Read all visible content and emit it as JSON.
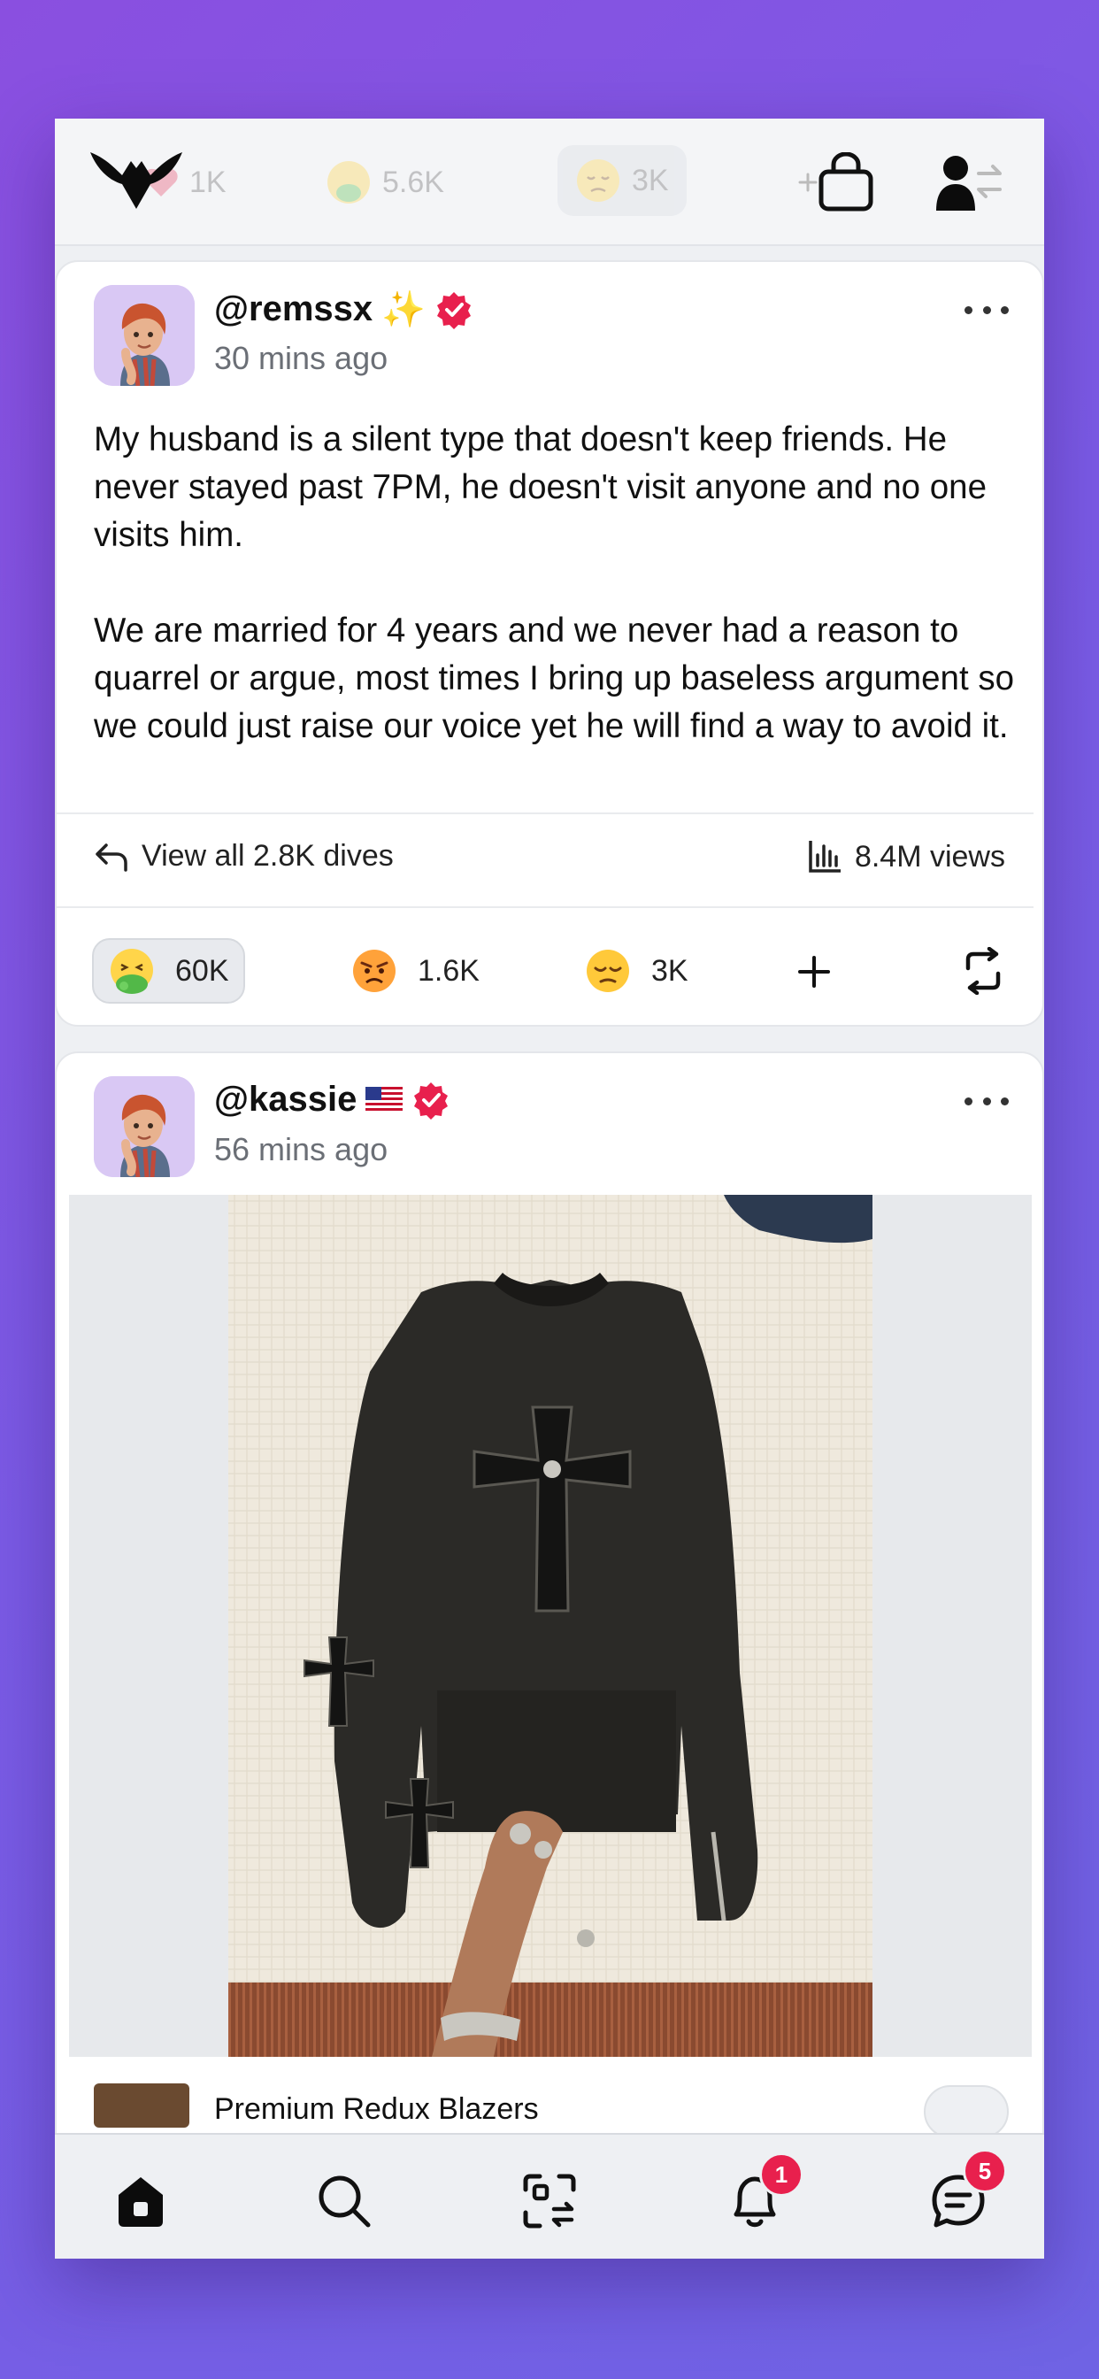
{
  "topbar": {
    "stats": [
      {
        "icon": "heart-icon",
        "value": "1K"
      },
      {
        "icon": "nauseated-face-icon",
        "value": "5.6K"
      },
      {
        "icon": "pensive-face-icon",
        "value": "3K"
      }
    ]
  },
  "posts": [
    {
      "handle": "@remssx",
      "handle_emoji": "✨",
      "time": "30 mins ago",
      "paragraphs": [
        "My husband is a silent type that doesn't keep friends. He never stayed past 7PM, he doesn't visit anyone and no one visits him.",
        "We are married for 4 years and we never had a reason to quarrel or argue, most times I bring up baseless argument so we could just raise our voice yet he will find a way to avoid it."
      ],
      "dives_label": "View all 2.8K dives",
      "views_label": "8.4M views",
      "reactions": [
        {
          "icon": "nauseated-face-icon",
          "count": "60K",
          "active": true
        },
        {
          "icon": "angry-face-icon",
          "count": "1.6K",
          "active": false
        },
        {
          "icon": "pensive-face-icon",
          "count": "3K",
          "active": false
        }
      ]
    },
    {
      "handle": "@kassie",
      "handle_emoji": "🇺🇸",
      "time": "56 mins ago"
    }
  ],
  "product": {
    "title": "Premium Redux Blazers"
  },
  "tabbar": {
    "notifications_badge": "1",
    "messages_badge": "5"
  },
  "colors": {
    "verified": "#e8204d",
    "background_gradient_start": "#8a4fe0",
    "background_gradient_end": "#6f63e4"
  }
}
